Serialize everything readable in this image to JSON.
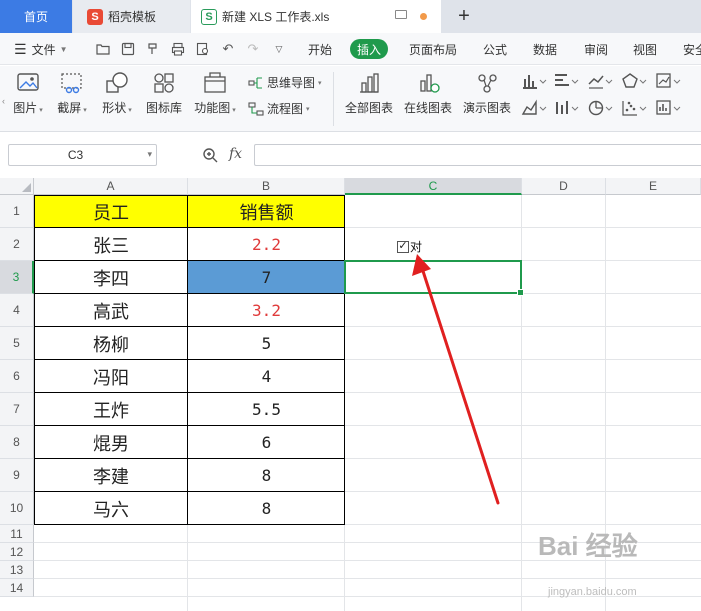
{
  "tabs": {
    "home": "首页",
    "template": "稻壳模板",
    "file": "新建 XLS 工作表.xls",
    "new_tab": "+"
  },
  "menu": {
    "hamburger_label": "文件",
    "items": [
      "开始",
      "插入",
      "页面布局",
      "公式",
      "数据",
      "审阅",
      "视图",
      "安全"
    ],
    "active": "插入"
  },
  "ribbon": {
    "items_left": [
      "图片",
      "截屏",
      "形状",
      "图标库",
      "功能图"
    ],
    "small_top": "思维导图",
    "small_bottom": "流程图",
    "chart_items": [
      "全部图表",
      "在线图表",
      "演示图表"
    ]
  },
  "formula_bar": {
    "cell_ref": "C3",
    "fx_label": "fx",
    "formula": ""
  },
  "sheet": {
    "columns": [
      "A",
      "B",
      "C",
      "D",
      "E"
    ],
    "rows": [
      "1",
      "2",
      "3",
      "4",
      "5",
      "6",
      "7",
      "8",
      "9",
      "10",
      "11",
      "12",
      "13",
      "14"
    ],
    "selected_cell": "C3",
    "header": {
      "a": "员工",
      "b": "销售额"
    },
    "data": [
      {
        "name": "张三",
        "value": "2.2",
        "highlight": "red"
      },
      {
        "name": "李四",
        "value": "7",
        "highlight": "blue-fill"
      },
      {
        "name": "高武",
        "value": "3.2",
        "highlight": "red"
      },
      {
        "name": "杨柳",
        "value": "5",
        "highlight": "none"
      },
      {
        "name": "冯阳",
        "value": "4",
        "highlight": "none"
      },
      {
        "name": "王炸",
        "value": "5.5",
        "highlight": "none"
      },
      {
        "name": "焜男",
        "value": "6",
        "highlight": "none"
      },
      {
        "name": "李建",
        "value": "8",
        "highlight": "none"
      },
      {
        "name": "马六",
        "value": "8",
        "highlight": "none"
      }
    ],
    "checkbox": {
      "label": "对",
      "checked": true
    }
  },
  "colors": {
    "accent_green": "#1f9a4c",
    "tab_blue": "#3c7be4",
    "header_fill": "#ffff00",
    "selected_fill": "#5b9bd5",
    "red_text": "#e03a3a",
    "arrow": "#e02020"
  },
  "watermark": {
    "brand": "Bai 经验",
    "url": "jingyan.baidu.com"
  }
}
